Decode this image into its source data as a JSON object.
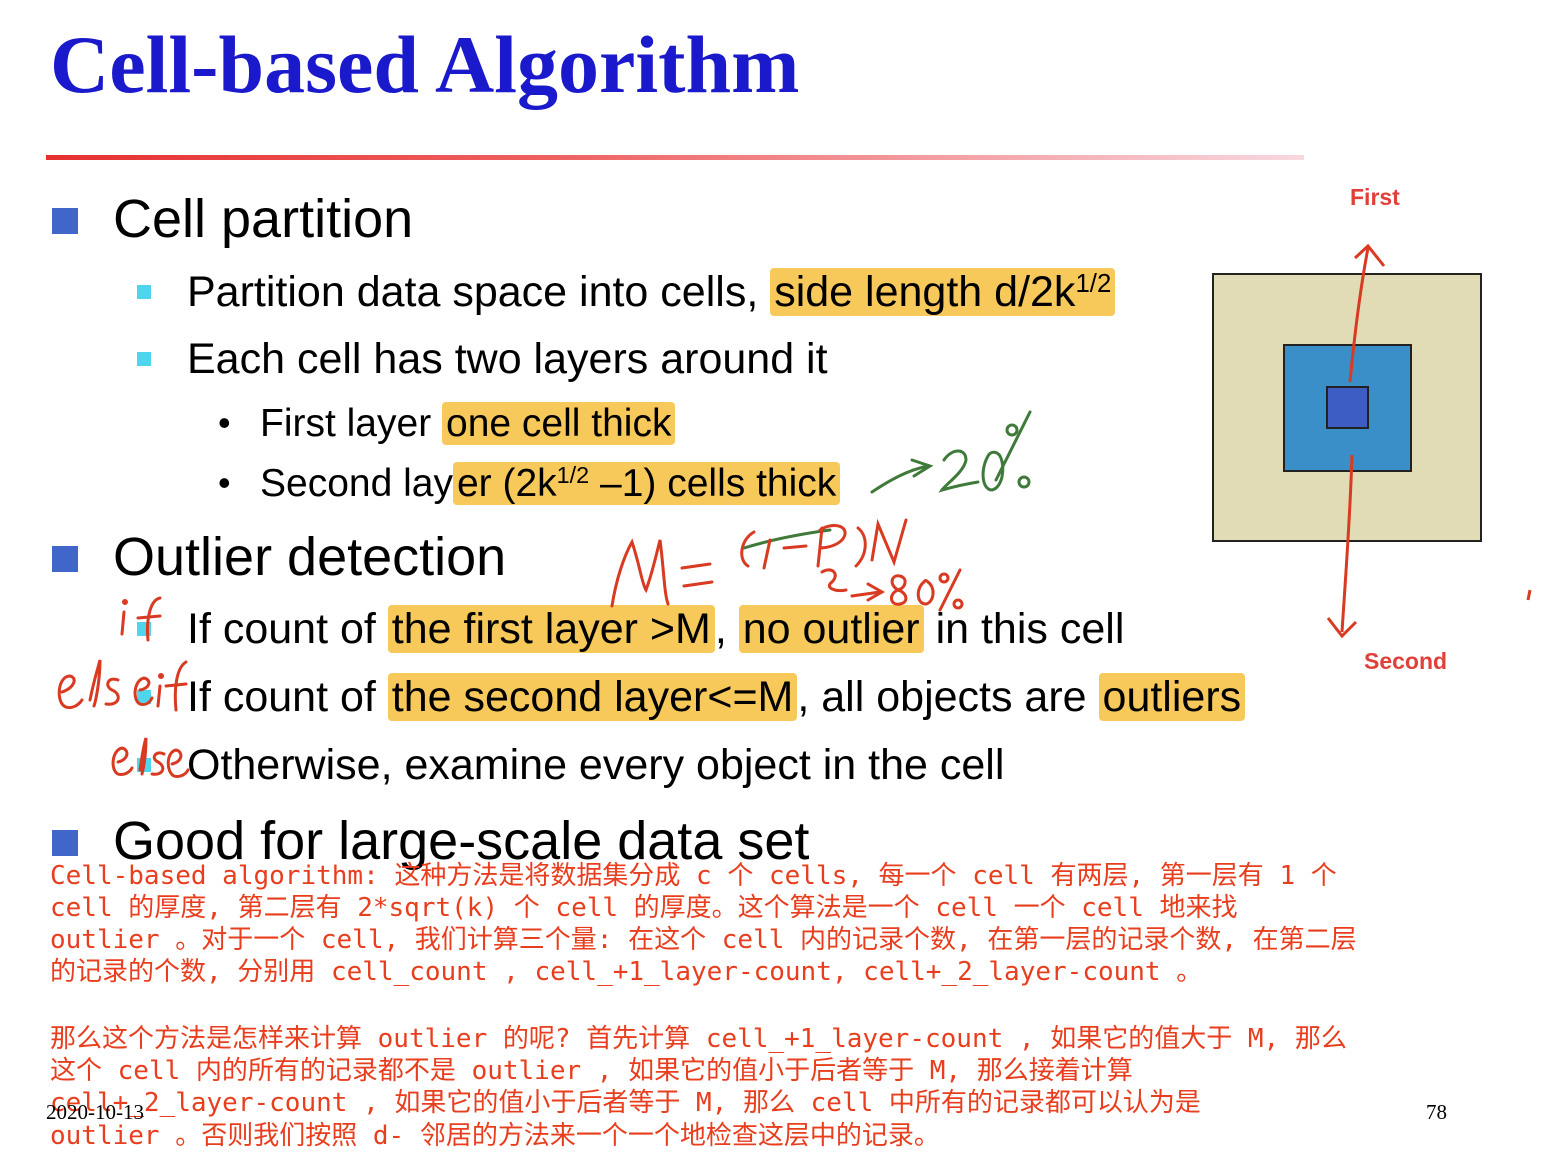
{
  "slide": {
    "title": "Cell-based Algorithm",
    "sections": [
      {
        "heading": "Cell partition"
      },
      {
        "heading": "Outlier detection"
      },
      {
        "heading": "Good for large-scale data set"
      }
    ],
    "partition": {
      "item1_prefix": "Partition data space into cells, ",
      "item1_highlight": "side length d/2k",
      "item1_sup": "1/2",
      "item2": "Each cell has two layers around it",
      "sub1_prefix": "First layer ",
      "sub1_highlight": "one cell thick",
      "sub2_prefix": "Second lay",
      "sub2_hl_a": "er (2k",
      "sub2_hl_sup": "1/2",
      "sub2_hl_b": " –1) cells thick"
    },
    "detection": {
      "r1_a": "If count of ",
      "r1_hl1": "the first layer >M",
      "r1_b": ", ",
      "r1_hl2": "no outlier",
      "r1_c": " in this cell",
      "r2_a": "If count of ",
      "r2_hl1": "the second layer<=M",
      "r2_b": ", all objects are ",
      "r2_hl2": "outliers",
      "r3": "Otherwise, examine every object in the cell"
    },
    "diagram": {
      "first_label": "First",
      "second_label": "Second"
    },
    "handwriting": {
      "if": "if",
      "elseif": "elseif",
      "else": "else",
      "pct20": "20%",
      "formula": "M = (1-p)N",
      "pct80": "80%"
    },
    "notes": [
      "Cell-based algorithm: 这种方法是将数据集分成 c 个 cells, 每一个 cell 有两层, 第一层有 1 个",
      "cell 的厚度, 第二层有 2*sqrt(k) 个 cell 的厚度。这个算法是一个 cell 一个 cell 地来找",
      "outlier 。对于一个 cell, 我们计算三个量: 在这个 cell 内的记录个数, 在第一层的记录个数, 在第二层",
      "的记录的个数, 分别用 cell_count ,  cell_+1_layer-count, cell+_2_layer-count 。",
      "",
      "那么这个方法是怎样来计算 outlier 的呢? 首先计算 cell_+1_layer-count , 如果它的值大于 M, 那么",
      "这个 cell 内的所有的记录都不是 outlier , 如果它的值小于后者等于 M, 那么接着计算",
      "cell+_2_layer-count , 如果它的值小于后者等于 M, 那么 cell 中所有的记录都可以认为是",
      "outlier 。否则我们按照 d- 邻居的方法来一个一个地检查这层中的记录。"
    ],
    "footer": {
      "date": "2020-10-13",
      "page": "78"
    },
    "colors": {
      "title": "#1a1acc",
      "highlight": "#f7c95a",
      "annotation_red": "#d83a22",
      "annotation_green": "#3f7a3a"
    }
  }
}
